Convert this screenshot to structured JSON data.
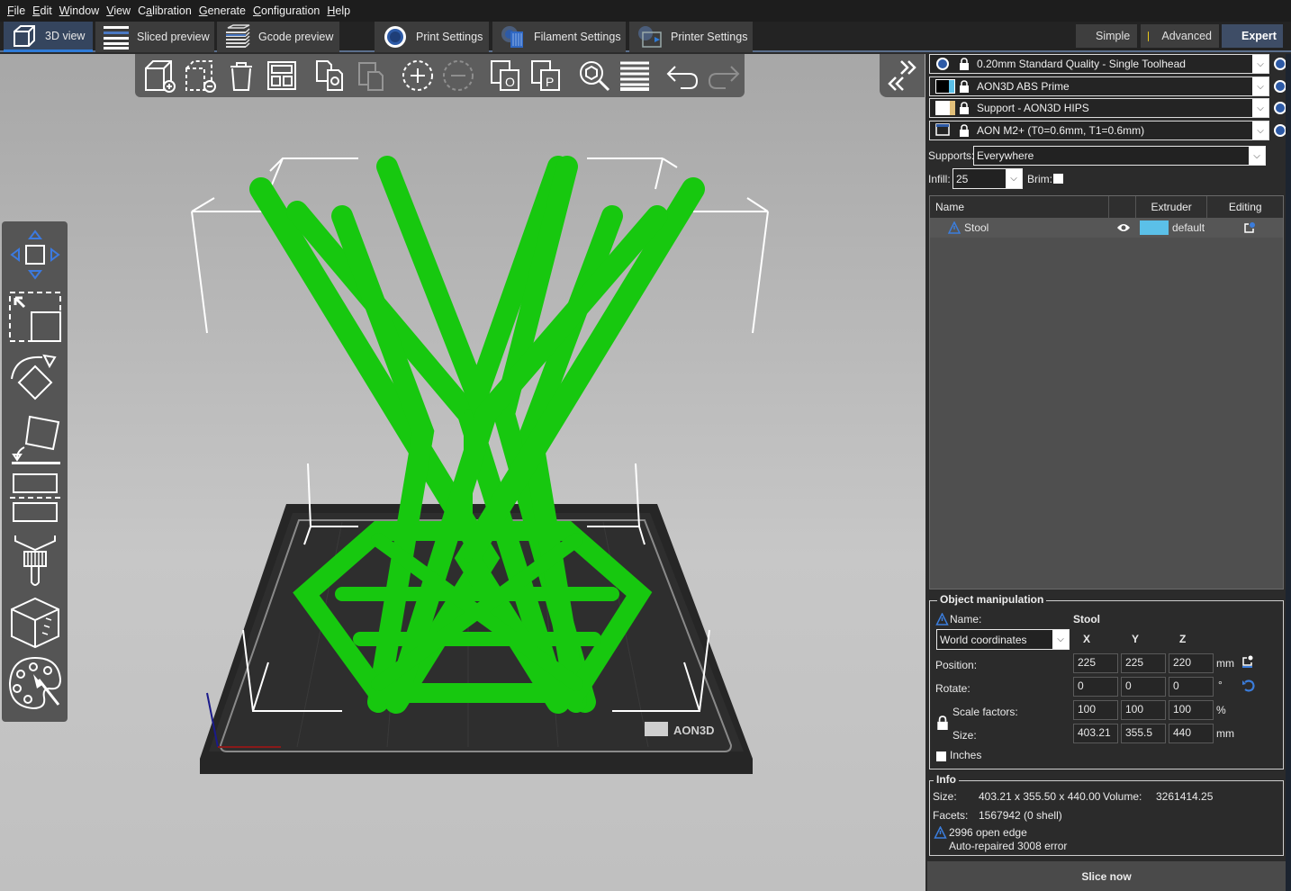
{
  "menu": {
    "items": [
      {
        "label": "File",
        "accel": "F"
      },
      {
        "label": "Edit",
        "accel": "E"
      },
      {
        "label": "Window",
        "accel": "W"
      },
      {
        "label": "View",
        "accel": "V"
      },
      {
        "label": "Calibration",
        "accel": "a"
      },
      {
        "label": "Generate",
        "accel": "G"
      },
      {
        "label": "Configuration",
        "accel": "C"
      },
      {
        "label": "Help",
        "accel": "H"
      }
    ]
  },
  "tabs": [
    {
      "label": "3D view",
      "icon": "cube-icon",
      "active": true
    },
    {
      "label": "Sliced preview",
      "icon": "layers-icon",
      "active": false
    },
    {
      "label": "Gcode preview",
      "icon": "gcode-stack-icon",
      "active": false
    },
    {
      "label": "Print Settings",
      "icon": "gear-icon",
      "active": false
    },
    {
      "label": "Filament Settings",
      "icon": "filament-spool-icon",
      "active": false
    },
    {
      "label": "Printer Settings",
      "icon": "printer-icon",
      "active": false
    }
  ],
  "modes": [
    {
      "label": "Simple",
      "color": "#5fd13a",
      "active": false
    },
    {
      "label": "Advanced",
      "color": "#e8c81a",
      "active": false
    },
    {
      "label": "Expert",
      "color": "#e01414",
      "active": true
    }
  ],
  "toolbar": {
    "buttons": [
      {
        "name": "add-object",
        "icon": "add-cube-icon",
        "enabled": true
      },
      {
        "name": "delete-object",
        "icon": "delete-cube-icon",
        "enabled": true
      },
      {
        "name": "delete-all",
        "icon": "trash-icon",
        "enabled": true
      },
      {
        "name": "arrange",
        "icon": "arrange-icon",
        "enabled": true
      },
      {
        "name": "copy",
        "icon": "copy-icon",
        "enabled": true
      },
      {
        "name": "paste",
        "icon": "paste-icon",
        "enabled": false
      },
      {
        "name": "add-instance",
        "icon": "add-instance-icon",
        "enabled": true
      },
      {
        "name": "remove-instance",
        "icon": "remove-instance-icon",
        "enabled": false
      },
      {
        "name": "split-objects",
        "icon": "split-objects-icon",
        "enabled": true
      },
      {
        "name": "split-parts",
        "icon": "split-parts-icon",
        "enabled": true
      },
      {
        "name": "search",
        "icon": "search-icon",
        "enabled": true
      },
      {
        "name": "layers-editing",
        "icon": "layers-editing-icon",
        "enabled": true
      },
      {
        "name": "undo",
        "icon": "undo-icon",
        "enabled": true
      },
      {
        "name": "redo",
        "icon": "redo-icon",
        "enabled": false
      }
    ]
  },
  "left_toolbar": [
    {
      "name": "move",
      "icon": "move-icon"
    },
    {
      "name": "scale",
      "icon": "scale-icon"
    },
    {
      "name": "rotate",
      "icon": "rotate-icon"
    },
    {
      "name": "place-on-face",
      "icon": "place-on-face-icon"
    },
    {
      "name": "cut",
      "icon": "cut-icon"
    },
    {
      "name": "support-paint",
      "icon": "support-paint-icon"
    },
    {
      "name": "seam-paint",
      "icon": "seam-paint-icon"
    },
    {
      "name": "mmu-paint",
      "icon": "palette-icon"
    }
  ],
  "viewport": {
    "bed_logo": "AON3D",
    "object_color": "#17c80f"
  },
  "presets": {
    "print": {
      "label": "0.20mm Standard Quality - Single Toolhead"
    },
    "filament1": {
      "label": "AON3D ABS Prime",
      "swatch": [
        "#000000",
        "#5bc0e8"
      ]
    },
    "filament2": {
      "label": "Support - AON3D HIPS",
      "swatch": [
        "#ffffff",
        "#e2c07a"
      ]
    },
    "printer": {
      "label": "AON M2+ (T0=0.6mm, T1=0.6mm)"
    }
  },
  "quick": {
    "supports_label": "Supports:",
    "supports_value": "Everywhere",
    "infill_label": "Infill:",
    "infill_value": "25",
    "brim_label": "Brim:",
    "brim_checked": false
  },
  "object_list": {
    "headers": {
      "name": "Name",
      "extruder": "Extruder",
      "editing": "Editing"
    },
    "rows": [
      {
        "name": "Stool",
        "warning": true,
        "visible": true,
        "extruder": "default",
        "extruder_color": "#5bc0e8"
      }
    ]
  },
  "object_manipulation": {
    "title": "Object manipulation",
    "name_label": "Name:",
    "name_value": "Stool",
    "coords": "World coordinates",
    "axes": [
      "X",
      "Y",
      "Z"
    ],
    "position": {
      "label": "Position:",
      "values": [
        "225",
        "225",
        "220"
      ],
      "unit": "mm"
    },
    "rotate": {
      "label": "Rotate:",
      "values": [
        "0",
        "0",
        "0"
      ],
      "unit": "°"
    },
    "scale": {
      "label": "Scale factors:",
      "values": [
        "100",
        "100",
        "100"
      ],
      "unit": "%"
    },
    "size": {
      "label": "Size:",
      "values": [
        "403.21",
        "355.5",
        "440"
      ],
      "unit": "mm"
    },
    "inches_label": "Inches",
    "inches_checked": false
  },
  "info": {
    "title": "Info",
    "size_label": "Size:",
    "size_value": "403.21 x 355.50 x 440.00",
    "volume_label": "Volume:",
    "volume_value": "3261414.25",
    "facets_label": "Facets:",
    "facets_value": "1567942 (0 shell)",
    "warning_line1": "2996 open edge",
    "warning_line2": "Auto-repaired 3008 error"
  },
  "slice_button": "Slice now"
}
